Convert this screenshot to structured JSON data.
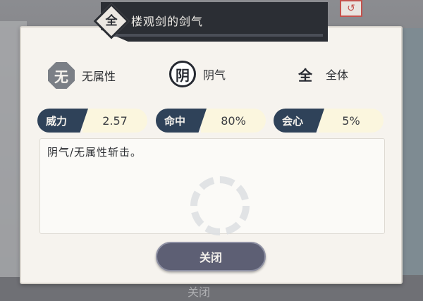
{
  "title": {
    "badge": "全",
    "name": "楼观剑的剑气"
  },
  "attributes": [
    {
      "icon": "无-glyph-icon",
      "glyph": "无",
      "label": "无属性"
    },
    {
      "icon": "阴-glyph-icon",
      "glyph": "阴",
      "label": "阴气"
    },
    {
      "icon": "全-glyph-icon",
      "glyph": "全",
      "label": "全体"
    }
  ],
  "stats": [
    {
      "key": "威力",
      "value": "2.57"
    },
    {
      "key": "命中",
      "value": "80%"
    },
    {
      "key": "会心",
      "value": "5%"
    }
  ],
  "description": "阴气/无属性斩击。",
  "close_button": "关闭",
  "background": {
    "bottom_text": "关闭"
  },
  "colors": {
    "banner": "#2b2e34",
    "stat_key": "#2f4259",
    "stat_value_bg": "#fbf6de",
    "button": "#5d5f74",
    "panel": "#f6f3ee"
  }
}
